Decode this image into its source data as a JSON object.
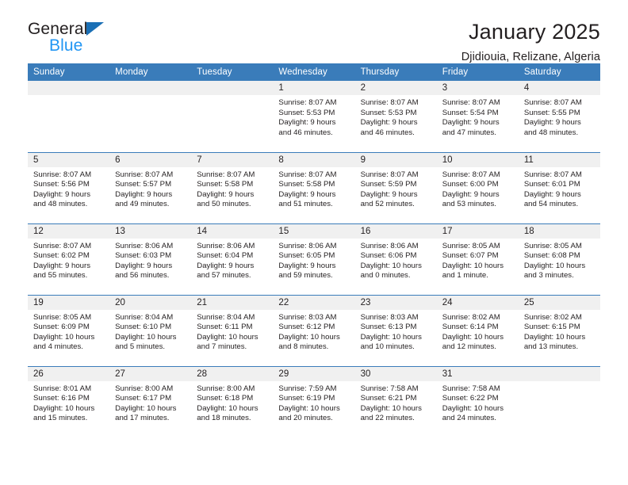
{
  "brand": {
    "name_top": "General",
    "name_bottom": "Blue",
    "triangle_color": "#1a6fb5",
    "blue_text_color": "#2196f3"
  },
  "header": {
    "title": "January 2025",
    "subtitle": "Djidiouia, Relizane, Algeria"
  },
  "theme": {
    "header_blue": "#3a7cba",
    "daynum_band": "#f0f0f0",
    "text": "#231f20"
  },
  "calendar": {
    "weekday_headers": [
      "Sunday",
      "Monday",
      "Tuesday",
      "Wednesday",
      "Thursday",
      "Friday",
      "Saturday"
    ],
    "weeks": [
      [
        {
          "day": "",
          "lines": []
        },
        {
          "day": "",
          "lines": []
        },
        {
          "day": "",
          "lines": []
        },
        {
          "day": "1",
          "lines": [
            "Sunrise: 8:07 AM",
            "Sunset: 5:53 PM",
            "Daylight: 9 hours",
            "and 46 minutes."
          ]
        },
        {
          "day": "2",
          "lines": [
            "Sunrise: 8:07 AM",
            "Sunset: 5:53 PM",
            "Daylight: 9 hours",
            "and 46 minutes."
          ]
        },
        {
          "day": "3",
          "lines": [
            "Sunrise: 8:07 AM",
            "Sunset: 5:54 PM",
            "Daylight: 9 hours",
            "and 47 minutes."
          ]
        },
        {
          "day": "4",
          "lines": [
            "Sunrise: 8:07 AM",
            "Sunset: 5:55 PM",
            "Daylight: 9 hours",
            "and 48 minutes."
          ]
        }
      ],
      [
        {
          "day": "5",
          "lines": [
            "Sunrise: 8:07 AM",
            "Sunset: 5:56 PM",
            "Daylight: 9 hours",
            "and 48 minutes."
          ]
        },
        {
          "day": "6",
          "lines": [
            "Sunrise: 8:07 AM",
            "Sunset: 5:57 PM",
            "Daylight: 9 hours",
            "and 49 minutes."
          ]
        },
        {
          "day": "7",
          "lines": [
            "Sunrise: 8:07 AM",
            "Sunset: 5:58 PM",
            "Daylight: 9 hours",
            "and 50 minutes."
          ]
        },
        {
          "day": "8",
          "lines": [
            "Sunrise: 8:07 AM",
            "Sunset: 5:58 PM",
            "Daylight: 9 hours",
            "and 51 minutes."
          ]
        },
        {
          "day": "9",
          "lines": [
            "Sunrise: 8:07 AM",
            "Sunset: 5:59 PM",
            "Daylight: 9 hours",
            "and 52 minutes."
          ]
        },
        {
          "day": "10",
          "lines": [
            "Sunrise: 8:07 AM",
            "Sunset: 6:00 PM",
            "Daylight: 9 hours",
            "and 53 minutes."
          ]
        },
        {
          "day": "11",
          "lines": [
            "Sunrise: 8:07 AM",
            "Sunset: 6:01 PM",
            "Daylight: 9 hours",
            "and 54 minutes."
          ]
        }
      ],
      [
        {
          "day": "12",
          "lines": [
            "Sunrise: 8:07 AM",
            "Sunset: 6:02 PM",
            "Daylight: 9 hours",
            "and 55 minutes."
          ]
        },
        {
          "day": "13",
          "lines": [
            "Sunrise: 8:06 AM",
            "Sunset: 6:03 PM",
            "Daylight: 9 hours",
            "and 56 minutes."
          ]
        },
        {
          "day": "14",
          "lines": [
            "Sunrise: 8:06 AM",
            "Sunset: 6:04 PM",
            "Daylight: 9 hours",
            "and 57 minutes."
          ]
        },
        {
          "day": "15",
          "lines": [
            "Sunrise: 8:06 AM",
            "Sunset: 6:05 PM",
            "Daylight: 9 hours",
            "and 59 minutes."
          ]
        },
        {
          "day": "16",
          "lines": [
            "Sunrise: 8:06 AM",
            "Sunset: 6:06 PM",
            "Daylight: 10 hours",
            "and 0 minutes."
          ]
        },
        {
          "day": "17",
          "lines": [
            "Sunrise: 8:05 AM",
            "Sunset: 6:07 PM",
            "Daylight: 10 hours",
            "and 1 minute."
          ]
        },
        {
          "day": "18",
          "lines": [
            "Sunrise: 8:05 AM",
            "Sunset: 6:08 PM",
            "Daylight: 10 hours",
            "and 3 minutes."
          ]
        }
      ],
      [
        {
          "day": "19",
          "lines": [
            "Sunrise: 8:05 AM",
            "Sunset: 6:09 PM",
            "Daylight: 10 hours",
            "and 4 minutes."
          ]
        },
        {
          "day": "20",
          "lines": [
            "Sunrise: 8:04 AM",
            "Sunset: 6:10 PM",
            "Daylight: 10 hours",
            "and 5 minutes."
          ]
        },
        {
          "day": "21",
          "lines": [
            "Sunrise: 8:04 AM",
            "Sunset: 6:11 PM",
            "Daylight: 10 hours",
            "and 7 minutes."
          ]
        },
        {
          "day": "22",
          "lines": [
            "Sunrise: 8:03 AM",
            "Sunset: 6:12 PM",
            "Daylight: 10 hours",
            "and 8 minutes."
          ]
        },
        {
          "day": "23",
          "lines": [
            "Sunrise: 8:03 AM",
            "Sunset: 6:13 PM",
            "Daylight: 10 hours",
            "and 10 minutes."
          ]
        },
        {
          "day": "24",
          "lines": [
            "Sunrise: 8:02 AM",
            "Sunset: 6:14 PM",
            "Daylight: 10 hours",
            "and 12 minutes."
          ]
        },
        {
          "day": "25",
          "lines": [
            "Sunrise: 8:02 AM",
            "Sunset: 6:15 PM",
            "Daylight: 10 hours",
            "and 13 minutes."
          ]
        }
      ],
      [
        {
          "day": "26",
          "lines": [
            "Sunrise: 8:01 AM",
            "Sunset: 6:16 PM",
            "Daylight: 10 hours",
            "and 15 minutes."
          ]
        },
        {
          "day": "27",
          "lines": [
            "Sunrise: 8:00 AM",
            "Sunset: 6:17 PM",
            "Daylight: 10 hours",
            "and 17 minutes."
          ]
        },
        {
          "day": "28",
          "lines": [
            "Sunrise: 8:00 AM",
            "Sunset: 6:18 PM",
            "Daylight: 10 hours",
            "and 18 minutes."
          ]
        },
        {
          "day": "29",
          "lines": [
            "Sunrise: 7:59 AM",
            "Sunset: 6:19 PM",
            "Daylight: 10 hours",
            "and 20 minutes."
          ]
        },
        {
          "day": "30",
          "lines": [
            "Sunrise: 7:58 AM",
            "Sunset: 6:21 PM",
            "Daylight: 10 hours",
            "and 22 minutes."
          ]
        },
        {
          "day": "31",
          "lines": [
            "Sunrise: 7:58 AM",
            "Sunset: 6:22 PM",
            "Daylight: 10 hours",
            "and 24 minutes."
          ]
        },
        {
          "day": "",
          "lines": []
        }
      ]
    ]
  }
}
